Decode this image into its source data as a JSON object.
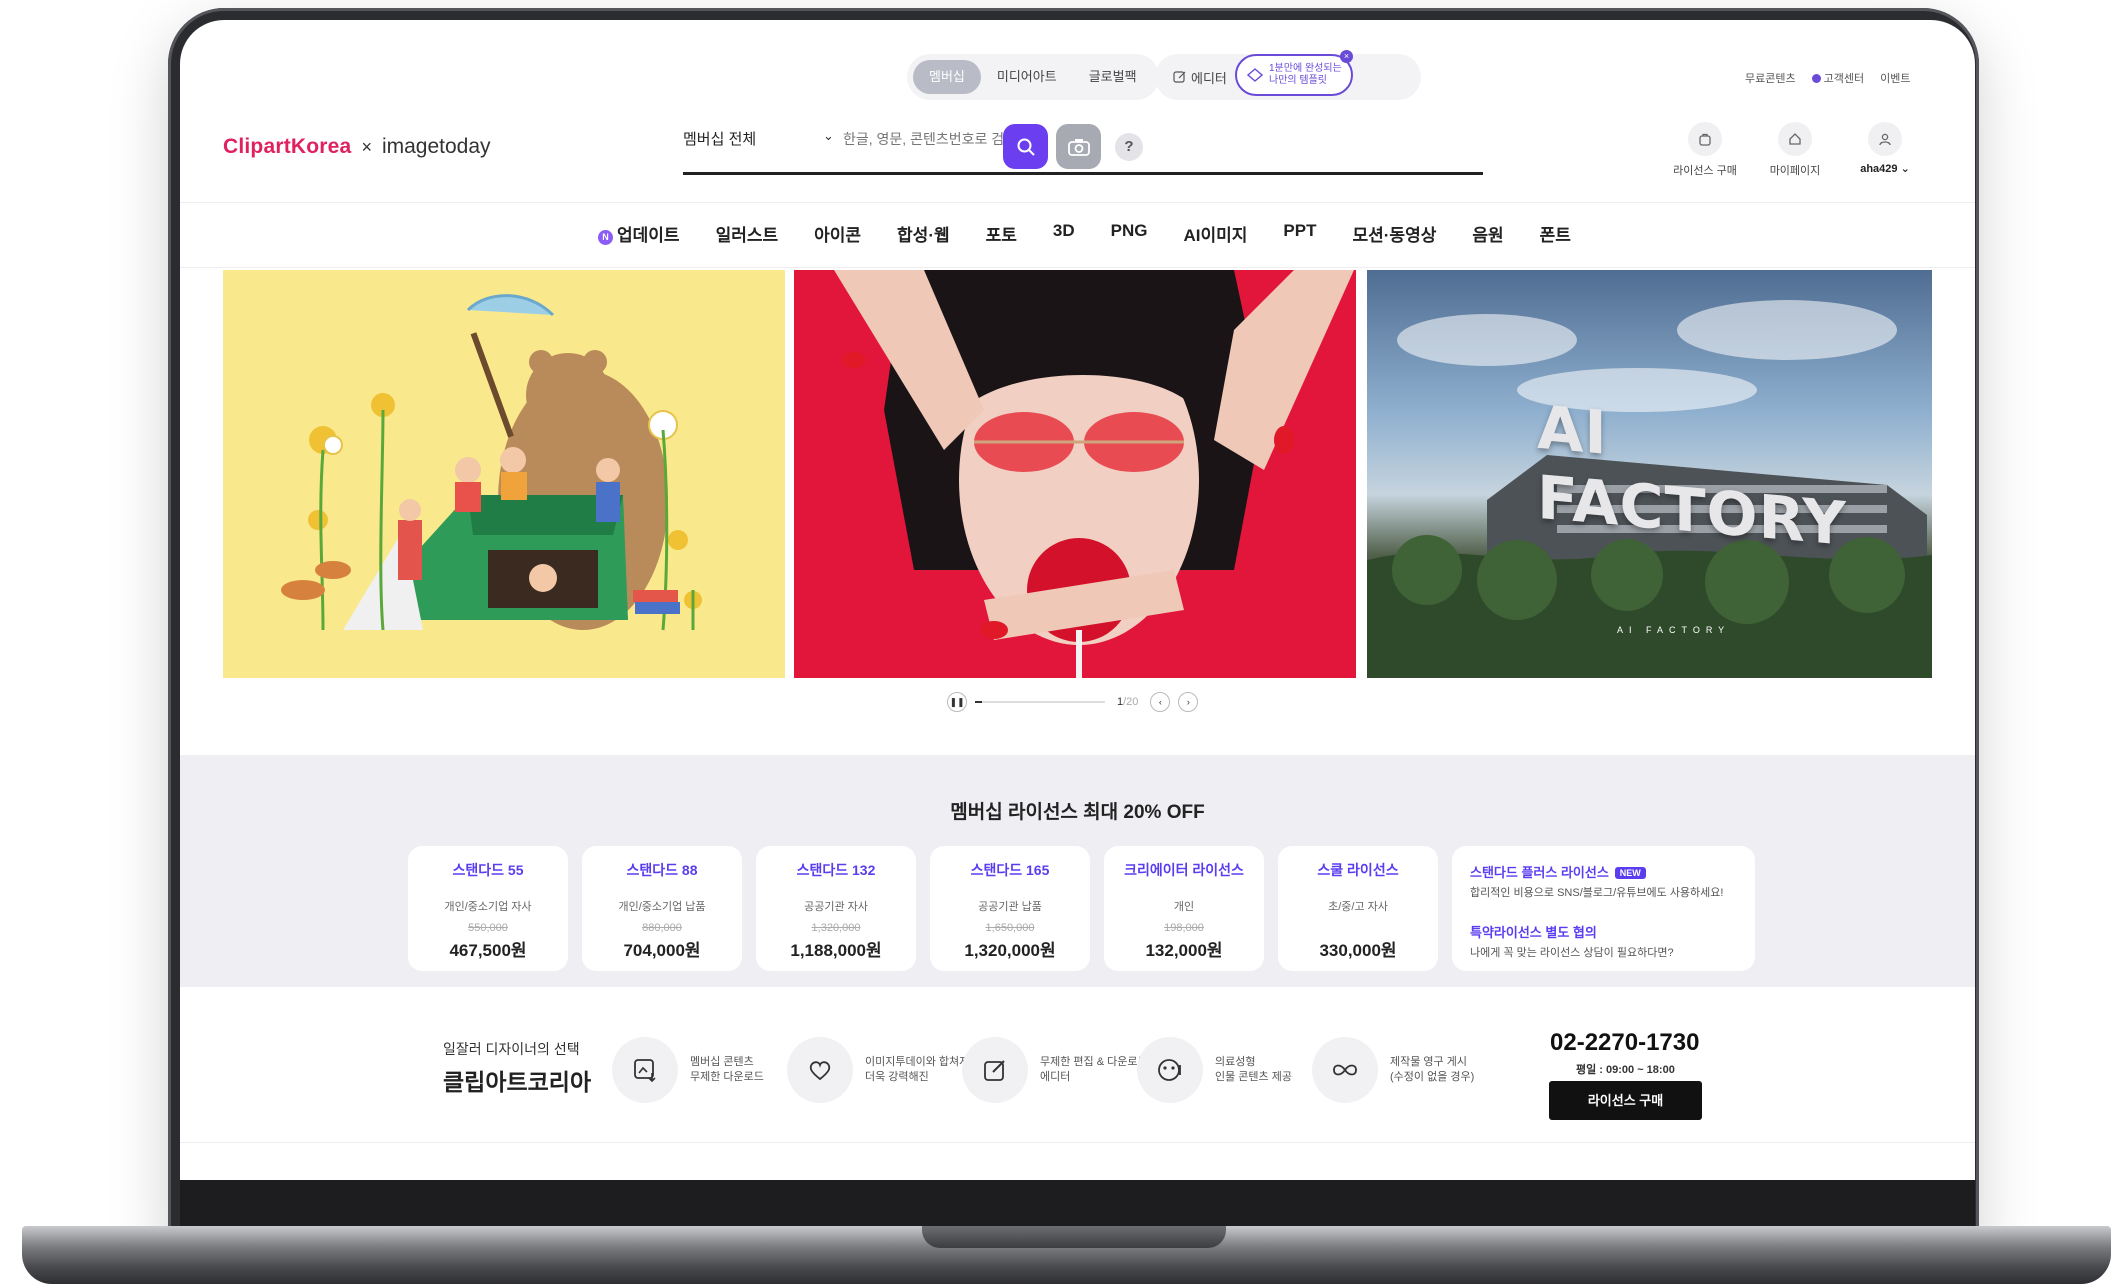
{
  "top_segments": [
    "멤버십",
    "미디어아트",
    "글로벌팩"
  ],
  "editor": {
    "label": "에디터",
    "promo": [
      "1분만에 완성되는",
      "나만의 템플릿"
    ],
    "close": "×"
  },
  "top_links": [
    "무료콘텐츠",
    "고객센터",
    "이벤트"
  ],
  "logo": {
    "brand": "ClipartKorea",
    "x": "×",
    "partner": "imagetoday"
  },
  "search": {
    "scope": "멤버십 전체",
    "placeholder": "한글, 영문, 콘텐츠번호로 검색"
  },
  "help": "?",
  "user_tools": [
    {
      "label": "라이선스 구매"
    },
    {
      "label": "마이페이지"
    },
    {
      "label": "aha429 ⌄"
    }
  ],
  "nav": {
    "new_badge": "N",
    "items": [
      "업데이트",
      "일러스트",
      "아이콘",
      "합성·웹",
      "포토",
      "3D",
      "PNG",
      "AI이미지",
      "PPT",
      "모션·동영상",
      "음원",
      "폰트"
    ]
  },
  "banners": {
    "factory_title": "AI FACTORY",
    "factory_sub": "AI FACTORY"
  },
  "slider": {
    "current": "1",
    "total": "/20",
    "progress": 0.05
  },
  "license": {
    "title": "멤버십 라이선스 최대 20% OFF",
    "cards": [
      {
        "name": "스탠다드 55",
        "desc": "개인/중소기업 자사",
        "orig": "550,000",
        "price": "467,500원"
      },
      {
        "name": "스탠다드 88",
        "desc": "개인/중소기업 납품",
        "orig": "880,000",
        "price": "704,000원"
      },
      {
        "name": "스탠다드 132",
        "desc": "공공기관 자사",
        "orig": "1,320,000",
        "price": "1,188,000원"
      },
      {
        "name": "스탠다드 165",
        "desc": "공공기관 납품",
        "orig": "1,650,000",
        "price": "1,320,000원"
      },
      {
        "name": "크리에이터 라이선스",
        "desc": "개인",
        "orig": "198,000",
        "price": "132,000원"
      },
      {
        "name": "스쿨 라이선스",
        "desc": "초/중/고 자사",
        "orig": "",
        "price": "330,000원"
      }
    ],
    "wide": {
      "title": "스탠다드 플러스 라이선스",
      "badge": "NEW",
      "desc": "합리적인 비용으로 SNS/블로그/유튜브에도 사용하세요!",
      "title2": "특약라이선스 별도 협의",
      "desc2": "나에게 꼭 맞는 라이선스 상담이 필요하다면?"
    }
  },
  "features": {
    "tagline_sub": "일잘러 디자이너의 선택",
    "tagline_main": "클립아트코리아",
    "items": [
      "멤버십 콘텐츠\n무제한 다운로드",
      "이미지투데이와 합쳐져\n더욱 강력해진",
      "무제한 편집 & 다운로드\n에디터",
      "의료성형\n인물 콘텐츠 제공",
      "제작물 영구 게시\n(수정이 없을 경우)"
    ],
    "phone": "02-2270-1730",
    "hours": "평일 : 09:00 ~ 18:00",
    "buy": "라이선스 구매"
  },
  "colors": {
    "brand": "#e0215f",
    "accent": "#6b3ef0",
    "card_name": "#5b3df0"
  }
}
